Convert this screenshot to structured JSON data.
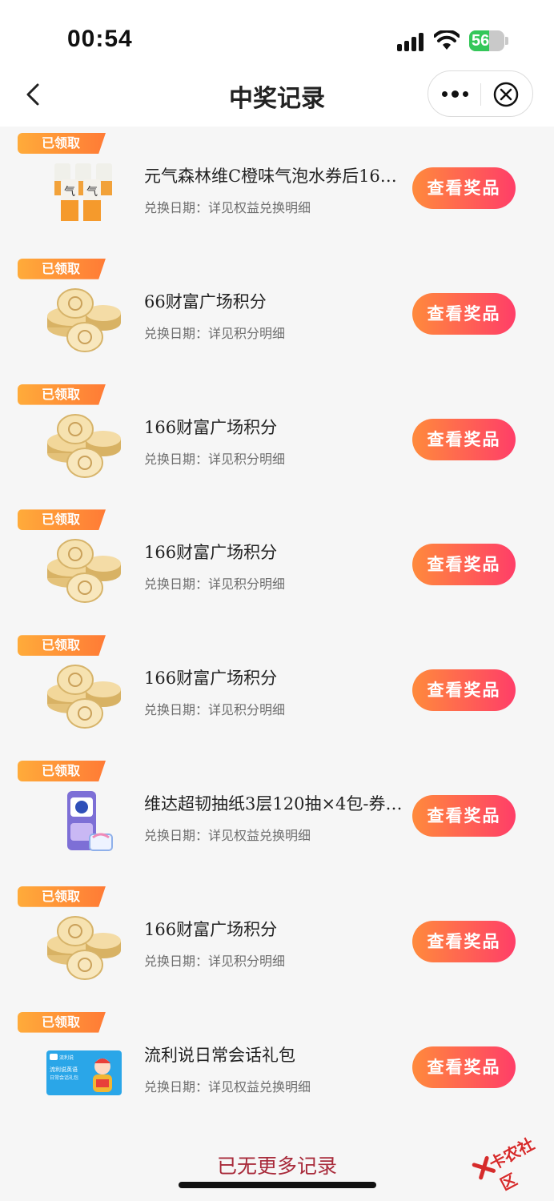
{
  "status_bar": {
    "time": "00:54",
    "battery_level": "56",
    "battery_fraction": 0.56,
    "battery_color": "#34c759"
  },
  "nav": {
    "title": "中奖记录",
    "back_icon": "chevron-left-icon",
    "more_icon": "more-dots-icon",
    "close_icon": "close-circle-icon"
  },
  "records": [
    {
      "badge": "已领取",
      "name": "元气森林维C橙味气泡水券后16…",
      "date": "兑换日期：详见权益兑换明细",
      "button": "查看奖品",
      "thumb": "soda-cans"
    },
    {
      "badge": "已领取",
      "name": "66财富广场积分",
      "date": "兑换日期：详见积分明细",
      "button": "查看奖品",
      "thumb": "gold-coins"
    },
    {
      "badge": "已领取",
      "name": "166财富广场积分",
      "date": "兑换日期：详见积分明细",
      "button": "查看奖品",
      "thumb": "gold-coins"
    },
    {
      "badge": "已领取",
      "name": "166财富广场积分",
      "date": "兑换日期：详见积分明细",
      "button": "查看奖品",
      "thumb": "gold-coins"
    },
    {
      "badge": "已领取",
      "name": "166财富广场积分",
      "date": "兑换日期：详见积分明细",
      "button": "查看奖品",
      "thumb": "gold-coins"
    },
    {
      "badge": "已领取",
      "name": "维达超韧抽纸3层120抽×4包-券…",
      "date": "兑换日期：详见权益兑换明细",
      "button": "查看奖品",
      "thumb": "tissue-pack"
    },
    {
      "badge": "已领取",
      "name": "166财富广场积分",
      "date": "兑换日期：详见积分明细",
      "button": "查看奖品",
      "thumb": "gold-coins"
    },
    {
      "badge": "已领取",
      "name": "流利说日常会话礼包",
      "date": "兑换日期：详见权益兑换明细",
      "button": "查看奖品",
      "thumb": "english-card"
    }
  ],
  "footer": {
    "no_more": "已无更多记录"
  },
  "watermark": {
    "text": "卡农社区"
  },
  "colors": {
    "badge": "#ff8a3a",
    "button_start": "#ff8a3c",
    "button_end": "#ff3e68",
    "footer_text": "#a82a3a"
  }
}
